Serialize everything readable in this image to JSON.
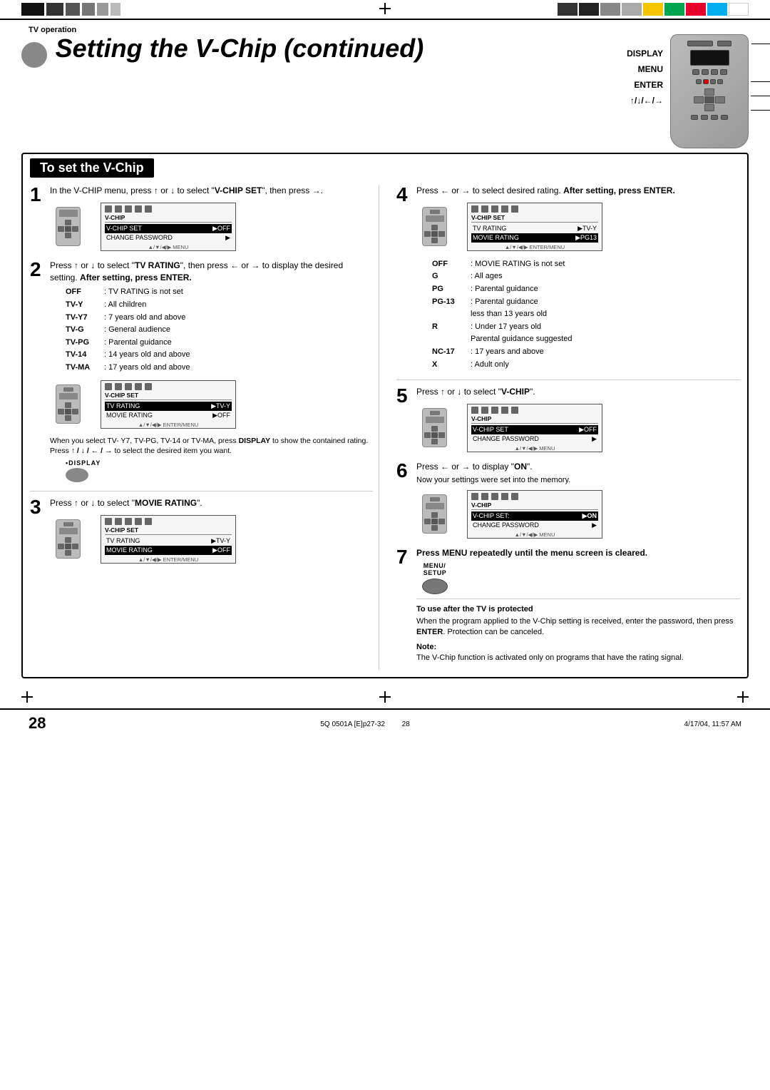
{
  "page": {
    "doc_label": "TV operation",
    "title": "Setting the V-Chip (continued)",
    "section_title": "To set the V-Chip",
    "page_num": "28",
    "footer_left": "5Q 0501A [E]p27-32",
    "footer_center": "28",
    "footer_right": "4/17/04, 11:57 AM"
  },
  "remote_labels": {
    "display": "DISPLAY",
    "menu": "MENU",
    "enter": "ENTER",
    "arrows": "↑/↓/←/→"
  },
  "steps": {
    "step1": {
      "num": "1",
      "text": "In the V-CHIP menu, press ↑ or ↓ to select \"V-CHIP SET\", then press →.",
      "screen": {
        "icons": [
          "□",
          "□",
          "□",
          "□",
          "□"
        ],
        "header": "V-CHIP",
        "rows": [
          {
            "label": "V-CHIP SET",
            "value": "▶OFF"
          },
          {
            "label": "CHANGE PASSWORD",
            "value": "▶"
          }
        ],
        "nav": "▲/▼/◀/▶ MENU"
      }
    },
    "step2": {
      "num": "2",
      "text": "Press ↑ or ↓ to select \"TV RATING\", then press ← or → to display the desired setting. After setting, press ENTER.",
      "list": [
        {
          "label": "OFF",
          "colon": ":",
          "desc": "TV RATING is not set"
        },
        {
          "label": "TV-Y",
          "colon": ":",
          "desc": "All children"
        },
        {
          "label": "TV-Y7",
          "colon": ":",
          "desc": "7 years old and above"
        },
        {
          "label": "TV-G",
          "colon": ":",
          "desc": "General audience"
        },
        {
          "label": "TV-PG",
          "colon": ":",
          "desc": "Parental guidance"
        },
        {
          "label": "TV-14",
          "colon": ":",
          "desc": "14 years old and above"
        },
        {
          "label": "TV-MA",
          "colon": ":",
          "desc": "17 years old and above"
        }
      ],
      "screen": {
        "icons": [
          "□",
          "□",
          "□",
          "□",
          "□"
        ],
        "header": "V-CHIP SET",
        "rows": [
          {
            "label": "TV RATING",
            "value": "▶TV-Y",
            "highlight": true
          },
          {
            "label": "MOVIE RATING",
            "value": "▶OFF"
          }
        ],
        "nav": "▲/▼/◀/▶ ENTER/MENU"
      },
      "display_note": "When you select TV-Y7, TV-PG, TV-14 or TV-MA, press DISPLAY to show the contained rating. Press ↑ / ↓ / ← / → to select the desired item you want.",
      "display_label": "•DISPLAY"
    },
    "step3": {
      "num": "3",
      "text": "Press ↑ or ↓ to select \"MOVIE RATING\".",
      "screen": {
        "icons": [
          "□",
          "□",
          "□",
          "□",
          "□"
        ],
        "header": "V-CHIP SET",
        "rows": [
          {
            "label": "TV RATING",
            "value": "▶TV-Y"
          },
          {
            "label": "MOVIE RATING",
            "value": "▶OFF",
            "highlight": true
          }
        ],
        "nav": "▲/▼/◀/▶ ENTER/MENU"
      }
    },
    "step4": {
      "num": "4",
      "text": "Press ← or → to select desired rating. After setting, press ENTER.",
      "list": [
        {
          "label": "OFF",
          "colon": ":",
          "desc": "MOVIE RATING is not set"
        },
        {
          "label": "G",
          "colon": ":",
          "desc": "All ages"
        },
        {
          "label": "PG",
          "colon": ":",
          "desc": "Parental guidance"
        },
        {
          "label": "PG-13",
          "colon": ":",
          "desc": "Parental guidance less than 13 years old"
        },
        {
          "label": "R",
          "colon": ":",
          "desc": "Under 17 years old Parental guidance suggested"
        },
        {
          "label": "NC-17",
          "colon": ":",
          "desc": "17 years and above"
        },
        {
          "label": "X",
          "colon": ":",
          "desc": "Adult only"
        }
      ],
      "screen": {
        "icons": [
          "□",
          "□",
          "□",
          "□",
          "□"
        ],
        "header": "V-CHIP SET",
        "rows": [
          {
            "label": "TV RATING",
            "value": "▶TV-Y"
          },
          {
            "label": "MOVIE RATING",
            "value": "▶PG13",
            "highlight": true
          }
        ],
        "nav": "▲/▼/◀/▶ ENTER/MENU"
      }
    },
    "step5": {
      "num": "5",
      "text": "Press ↑ or ↓ to select \"V-CHIP\".",
      "screen": {
        "icons": [
          "□",
          "□",
          "□",
          "□",
          "□"
        ],
        "header": "V-CHIP",
        "rows": [
          {
            "label": "V-CHIP SET",
            "value": "▶OFF"
          },
          {
            "label": "CHANGE PASSWORD",
            "value": "▶"
          }
        ],
        "nav": "▲/▼/◀/▶ MENU"
      }
    },
    "step6": {
      "num": "6",
      "text": "Press ← or → to display \"ON\".",
      "subtext": "Now your settings were set into the memory.",
      "screen": {
        "icons": [
          "□",
          "□",
          "□",
          "□",
          "□"
        ],
        "header": "V-CHIP",
        "rows": [
          {
            "label": "V-CHIP SET",
            "value": "▶ON",
            "highlight": true
          },
          {
            "label": "CHANGE PASSWORD",
            "value": "▶"
          }
        ],
        "nav": "▲/▼/◀/▶ MENU"
      }
    },
    "step7": {
      "num": "7",
      "text": "Press MENU repeatedly until the menu screen is cleared.",
      "menu_label": "MENU/ SETUP",
      "note_title": "To use after the TV is protected",
      "note_text": "When the program applied to the V-Chip setting is received, enter the password, then press ENTER. Protection can be canceled.",
      "note_label": "Note:",
      "note_text2": "The V-Chip function is activated only on programs that have the rating signal."
    }
  }
}
